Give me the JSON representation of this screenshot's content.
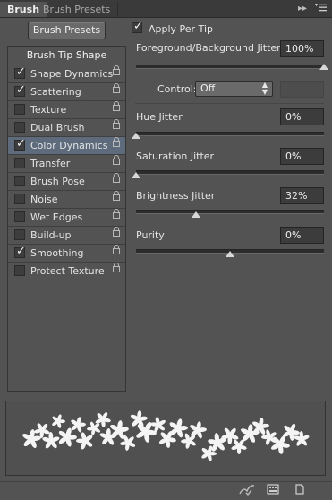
{
  "tabs": {
    "brush": "Brush",
    "brush_presets": "Brush Presets"
  },
  "header_icons": {
    "collapse": "double-arrow-right-icon",
    "menu": "panel-menu-icon"
  },
  "brush_presets_button": "Brush Presets",
  "list": {
    "header": "Brush Tip Shape",
    "items": [
      {
        "label": "Shape Dynamics",
        "checked": true
      },
      {
        "label": "Scattering",
        "checked": true
      },
      {
        "label": "Texture",
        "checked": false
      },
      {
        "label": "Dual Brush",
        "checked": false
      },
      {
        "label": "Color Dynamics",
        "checked": true,
        "selected": true
      },
      {
        "label": "Transfer",
        "checked": false
      },
      {
        "label": "Brush Pose",
        "checked": false
      },
      {
        "label": "Noise",
        "checked": false
      },
      {
        "label": "Wet Edges",
        "checked": false
      },
      {
        "label": "Build-up",
        "checked": false
      },
      {
        "label": "Smoothing",
        "checked": true
      },
      {
        "label": "Protect Texture",
        "checked": false
      }
    ]
  },
  "settings": {
    "apply_per_tip": "Apply Per Tip",
    "fg_bg_jitter": {
      "label": "Foreground/Background Jitter",
      "value": "100%",
      "level": 1.0
    },
    "control": {
      "label": "Control:",
      "value": "Off"
    },
    "hue_jitter": {
      "label": "Hue Jitter",
      "value": "0%",
      "level": 0.0
    },
    "saturation_jitter": {
      "label": "Saturation Jitter",
      "value": "0%",
      "level": 0.0
    },
    "brightness_jitter": {
      "label": "Brightness Jitter",
      "value": "32%",
      "level": 0.32
    },
    "purity": {
      "label": "Purity",
      "value": "0%",
      "level": 0.5
    }
  },
  "bottom_icons": [
    "toggle-live-tip-preview-icon",
    "open-preset-manager-icon",
    "create-new-brush-icon"
  ],
  "colors": {
    "selected_row": "#5e6b7d",
    "panel_bg": "#535353",
    "field_bg": "#3c3c3c"
  }
}
